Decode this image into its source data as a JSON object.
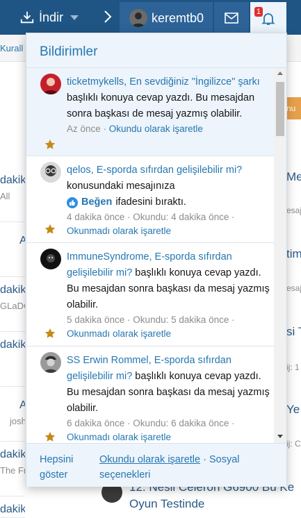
{
  "navbar": {
    "download_label": "İndir",
    "username": "keremtb0",
    "alert_badge": "1",
    "colors": {
      "bar": "#1f5585",
      "active": "#2d6397"
    }
  },
  "background": {
    "strip_text": "Kurall",
    "left_rows": [
      {
        "a": "dakik",
        "b": "All"
      },
      {
        "a": "A",
        "b": ""
      },
      {
        "a": "dakik",
        "b": "GLaDO"
      },
      {
        "a": "dakik",
        "b": ""
      },
      {
        "a": "A",
        "b": "josh"
      },
      {
        "a": "dakik",
        "b": "The Fr"
      },
      {
        "a": "dakik",
        "b": ""
      }
    ],
    "orange_button": "nu",
    "right_items": [
      {
        "title": "Me",
        "sub": "esaj"
      },
      {
        "title": "tim",
        "sub": "esaj"
      },
      {
        "title": "si T",
        "sub": "ij: 1"
      },
      {
        "title": "Ye",
        "sub": "ij: C"
      }
    ],
    "bottom_title": "12. Nesil Celeron G6900 Bu Ke Oyun Testinde"
  },
  "dropdown": {
    "title": "Bildirimler",
    "notifications": [
      {
        "unread": true,
        "avatar_icon": "user-avatar-red",
        "link": "ticketmykells, En sevdiğiniz \"İngilizce\" şarkı",
        "text": " başlıklı konuya cevap yazdı. Bu mesajdan sonra başkası de mesaj yazmış olabilir.",
        "time": "Az önce",
        "action": "Okundu olarak işaretle"
      },
      {
        "unread": false,
        "avatar_icon": "user-avatar-glasses",
        "link": "qelos, E-sporda sıfırdan gelişilebilir mi?",
        "text": " konusundaki mesajınıza",
        "reaction": "Beğen",
        "reaction_text": "ifadesini bıraktı.",
        "time": "4 dakika önce · Okundu: 4 dakika önce ·",
        "action": "Okunmadı olarak işaretle"
      },
      {
        "unread": false,
        "avatar_icon": "user-avatar-dark",
        "link": "ImmuneSyndrome, E-sporda sıfırdan gelişilebilir mi?",
        "text": " başlıklı konuya cevap yazdı. Bu mesajdan sonra başkası da mesaj yazmış olabilir.",
        "time": "5 dakika önce · Okundu: 5 dakika önce ·",
        "action": "Okunmadı olarak işaretle"
      },
      {
        "unread": false,
        "avatar_icon": "user-avatar-soldier",
        "link": "SS Erwin Rommel, E-sporda sıfırdan gelişilebilir mi?",
        "text": " başlıklı konuya cevap yazdı. Bu mesajdan sonra başkası da mesaj yazmış olabilir.",
        "time": "6 dakika önce · Okundu: 6 dakika önce ·",
        "action": "Okunmadı olarak işaretle"
      }
    ],
    "footer": {
      "show_all": "Hepsini göster",
      "mark_read": "Okundu olarak işaretle",
      "separator": "·",
      "social": "Sosyal seçenekleri"
    },
    "colors": {
      "head": "#edf4fb",
      "link": "#2577b1",
      "star": "#c48a16"
    }
  }
}
